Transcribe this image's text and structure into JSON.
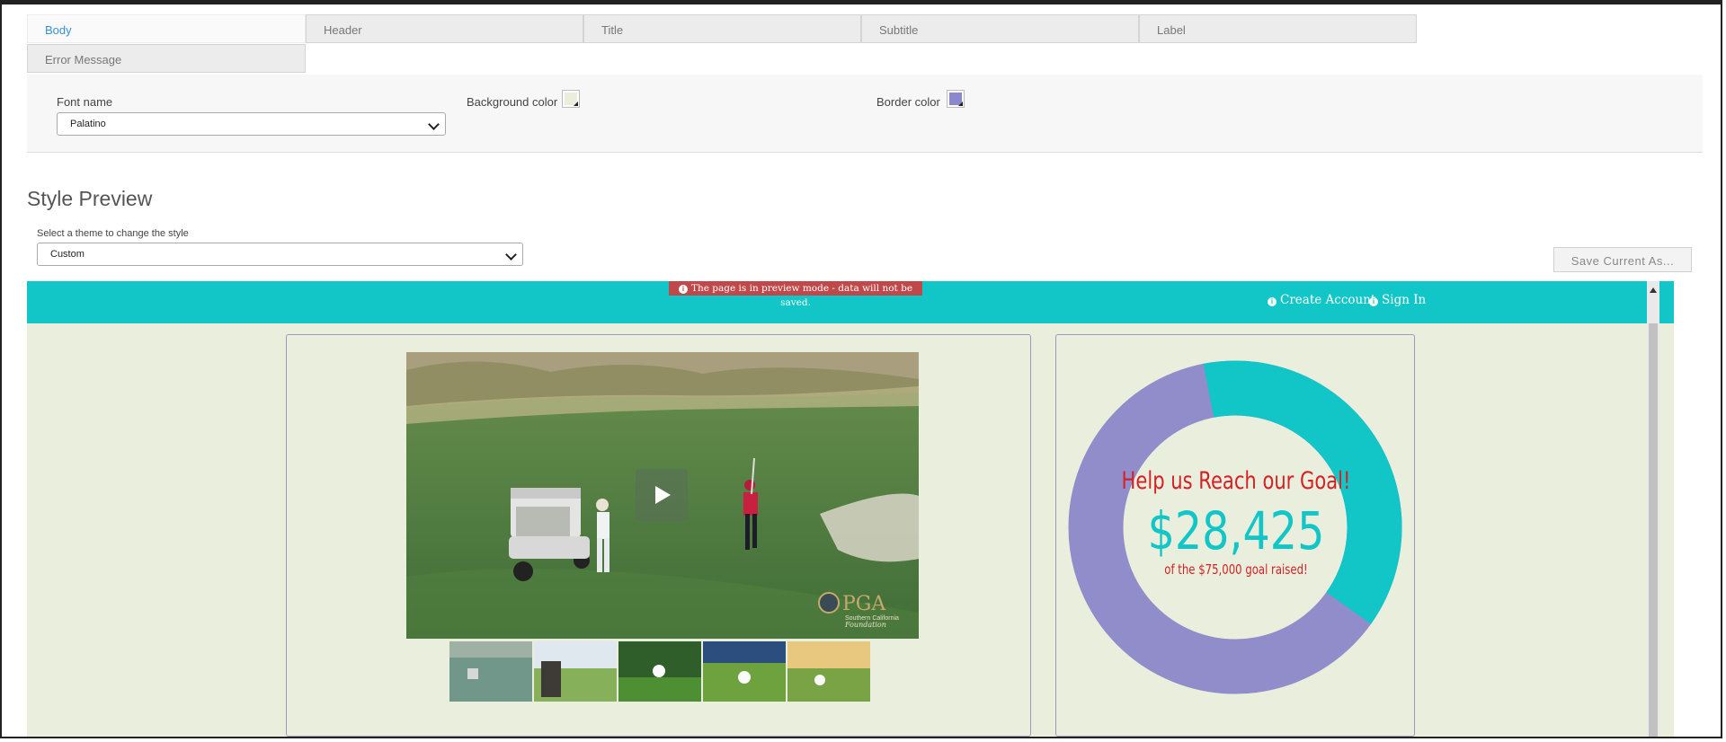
{
  "tabs": [
    {
      "label": "Body",
      "active": true
    },
    {
      "label": "Header",
      "active": false
    },
    {
      "label": "Title",
      "active": false
    },
    {
      "label": "Subtitle",
      "active": false
    },
    {
      "label": "Label",
      "active": false
    },
    {
      "label": "Error Message",
      "active": false
    }
  ],
  "settings": {
    "font_name_label": "Font name",
    "font_name_value": "Palatino",
    "background_color_label": "Background color",
    "background_color": "#e9efdc",
    "border_color_label": "Border color",
    "border_color": "#8c88cc"
  },
  "preview": {
    "heading": "Style Preview",
    "theme_label": "Select a theme to change the style",
    "theme_value": "Custom",
    "save_button": "Save Current As...",
    "notice": "The page is in preview mode - data will not be saved.",
    "nav": {
      "create_account": "Create Account",
      "sign_in": "Sign In"
    },
    "goal": {
      "title": "Help us Reach our Goal!",
      "amount": "$28,425",
      "subtitle": "of the $75,000 goal raised!",
      "raised": 28425,
      "target": 75000
    },
    "video_logo": "PGA",
    "video_logo_sub": "Southern California",
    "video_logo_sub2": "Foundation"
  },
  "colors": {
    "accent_teal": "#12c5c6",
    "ring_purple": "#918dcb",
    "goal_red": "#d42125",
    "notice_red": "#c0474a"
  }
}
